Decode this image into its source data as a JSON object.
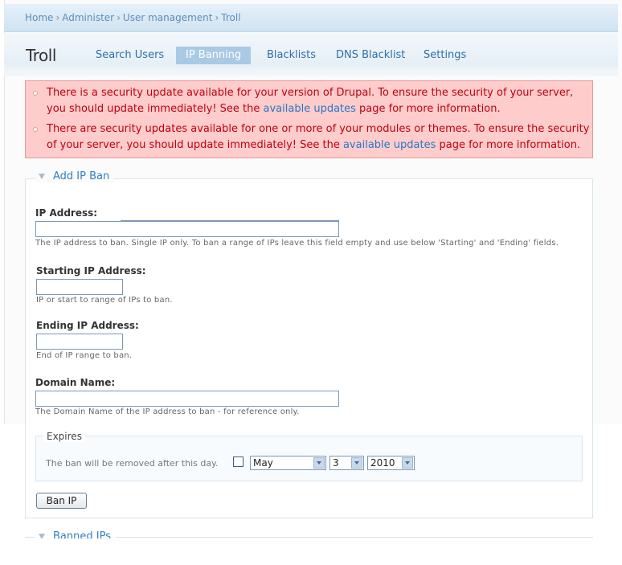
{
  "breadcrumb": {
    "items": [
      "Home",
      "Administer",
      "User management",
      "Troll"
    ],
    "separator": "›"
  },
  "page": {
    "title": "Troll",
    "tabs": [
      "Search Users",
      "IP Banning",
      "Blacklists",
      "DNS Blacklist",
      "Settings"
    ],
    "active_tab": "IP Banning"
  },
  "messages": {
    "m1_before": "There is a security update available for your version of Drupal. To ensure the security of your server, you should update immediately! See the ",
    "m1_link": "available updates",
    "m1_after": " page for more information.",
    "m2_before": "There are security updates available for one or more of your modules or themes. To ensure the security of your server, you should update immediately! See the ",
    "m2_link": "available updates",
    "m2_after": " page for more information."
  },
  "add_ban": {
    "legend": "Add IP Ban",
    "ip_label": "IP Address:",
    "ip_value": "",
    "ip_desc": "The IP address to ban. Single IP only. To ban a range of IPs leave this field empty and use below 'Starting' and 'Ending' fields.",
    "start_label": "Starting IP Address:",
    "start_value": "",
    "start_desc": "IP or start to range of IPs to ban.",
    "end_label": "Ending IP Address:",
    "end_value": "",
    "end_desc": "End of IP range to ban.",
    "domain_label": "Domain Name:",
    "domain_value": "",
    "domain_desc": "The Domain Name of the IP address to ban - for reference only.",
    "expires_legend": "Expires",
    "expires_text": "The ban will be removed after this day.",
    "expires_checked": false,
    "month": "May",
    "day": "3",
    "year": "2010",
    "button": "Ban IP"
  },
  "banned": {
    "legend": "Banned IPs"
  },
  "colors": {
    "link": "#2f6fa8",
    "error_bg": "#ffcccc",
    "error_text": "#c0000d",
    "active_tab": "#a9c9e4"
  }
}
